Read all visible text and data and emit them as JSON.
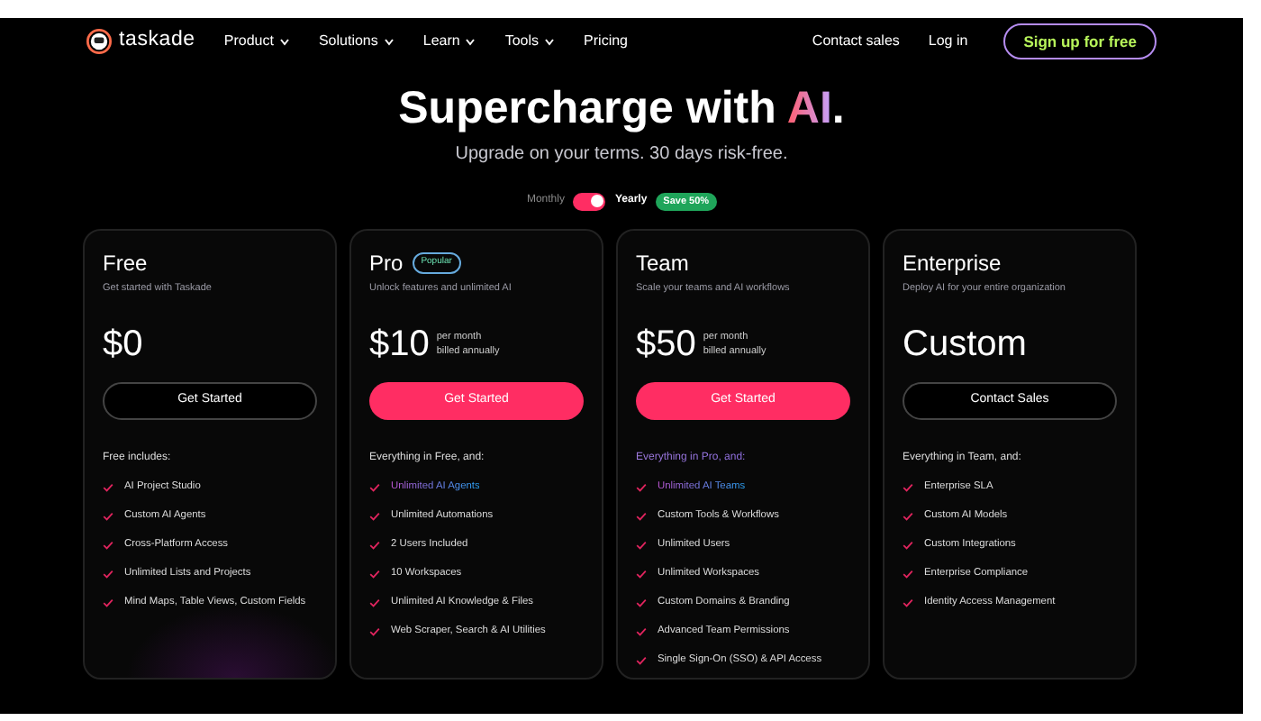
{
  "nav": {
    "brand": "taskade",
    "menu": [
      {
        "label": "Product",
        "dropdown": true
      },
      {
        "label": "Solutions",
        "dropdown": true
      },
      {
        "label": "Learn",
        "dropdown": true
      },
      {
        "label": "Tools",
        "dropdown": true
      },
      {
        "label": "Pricing",
        "dropdown": false
      }
    ],
    "links": [
      "Contact sales",
      "Log in"
    ],
    "cta": "Sign up for free"
  },
  "hero": {
    "title_parts": [
      {
        "text": "Supercharge with ",
        "accent": false
      },
      {
        "text": "AI",
        "accent": true
      },
      {
        "text": ".",
        "accent": false
      }
    ],
    "subtitle": "Upgrade on your terms. 30 days risk-free."
  },
  "billing": {
    "monthly": "Monthly",
    "yearly": "Yearly",
    "on": true,
    "badge": "Save 50%"
  },
  "plans": [
    {
      "name": "Free",
      "tagline": "Get started with Taskade",
      "price": "$0",
      "button": {
        "label": "Get Started",
        "kind": "outline"
      },
      "intro": {
        "text": "Free includes:",
        "highlight": false
      },
      "features": [
        {
          "text": "AI Project Studio",
          "highlight": false
        },
        {
          "text": "Custom AI Agents",
          "highlight": false
        },
        {
          "text": "Cross-Platform Access",
          "highlight": false
        },
        {
          "text": "Unlimited Lists and Projects",
          "highlight": false
        },
        {
          "text": "Mind Maps, Table Views, Custom Fields",
          "highlight": false
        }
      ]
    },
    {
      "name": "Pro",
      "badge": "Popular",
      "tagline": "Unlock features and unlimited AI",
      "price": "$10",
      "period": [
        "per month",
        "billed annually"
      ],
      "button": {
        "label": "Get Started",
        "kind": "filled"
      },
      "intro": {
        "text": "Everything in Free, and:",
        "highlight": false
      },
      "features": [
        {
          "text": "Unlimited AI Agents",
          "highlight": true
        },
        {
          "text": "Unlimited Automations",
          "highlight": false
        },
        {
          "text": "2 Users Included",
          "highlight": false
        },
        {
          "text": "10 Workspaces",
          "highlight": false
        },
        {
          "text": "Unlimited AI Knowledge & Files",
          "highlight": false
        },
        {
          "text": "Web Scraper, Search & AI Utilities",
          "highlight": false
        }
      ]
    },
    {
      "name": "Team",
      "tagline": "Scale your teams and AI workflows",
      "price": "$50",
      "period": [
        "per month",
        "billed annually"
      ],
      "button": {
        "label": "Get Started",
        "kind": "filled"
      },
      "intro": {
        "text": "Everything in Pro, and:",
        "highlight": true
      },
      "features": [
        {
          "text": "Unlimited AI Teams",
          "highlight": true
        },
        {
          "text": "Custom Tools & Workflows",
          "highlight": false
        },
        {
          "text": "Unlimited Users",
          "highlight": false
        },
        {
          "text": "Unlimited Workspaces",
          "highlight": false
        },
        {
          "text": "Custom Domains & Branding",
          "highlight": false
        },
        {
          "text": "Advanced Team Permissions",
          "highlight": false
        },
        {
          "text": "Single Sign-On (SSO) & API Access",
          "highlight": false
        }
      ]
    },
    {
      "name": "Enterprise",
      "tagline": "Deploy AI for your entire organization",
      "price": "Custom",
      "button": {
        "label": "Contact Sales",
        "kind": "outline"
      },
      "intro": {
        "text": "Everything in Team, and:",
        "highlight": false
      },
      "features": [
        {
          "text": "Enterprise SLA",
          "highlight": false
        },
        {
          "text": "Custom AI Models",
          "highlight": false
        },
        {
          "text": "Custom Integrations",
          "highlight": false
        },
        {
          "text": "Enterprise Compliance",
          "highlight": false
        },
        {
          "text": "Identity Access Management",
          "highlight": false
        }
      ]
    }
  ]
}
